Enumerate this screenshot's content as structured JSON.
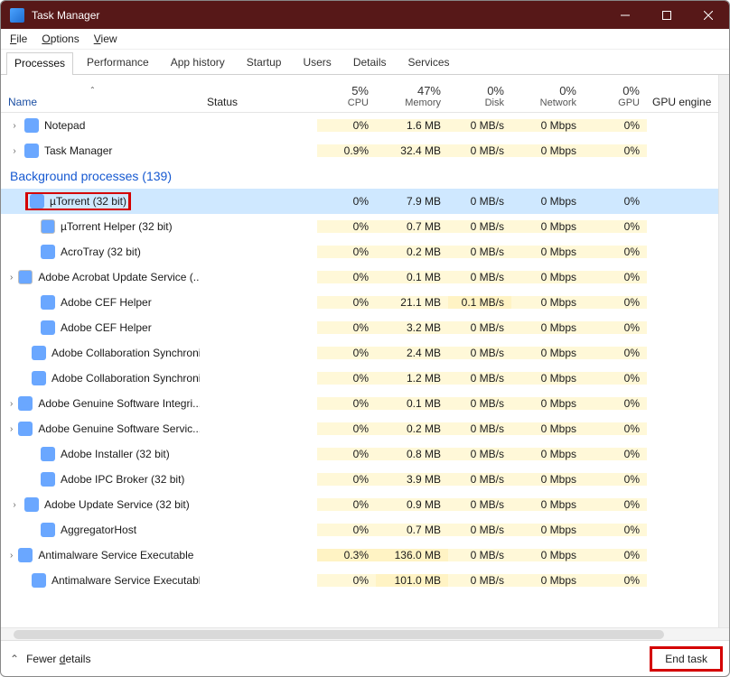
{
  "window": {
    "title": "Task Manager"
  },
  "menu": {
    "file": "File",
    "options": "Options",
    "view": "View"
  },
  "tabs": {
    "processes": "Processes",
    "performance": "Performance",
    "appHistory": "App history",
    "startup": "Startup",
    "users": "Users",
    "details": "Details",
    "services": "Services"
  },
  "columns": {
    "name": "Name",
    "status": "Status",
    "cpu_pct": "5%",
    "cpu_lbl": "CPU",
    "mem_pct": "47%",
    "mem_lbl": "Memory",
    "disk_pct": "0%",
    "disk_lbl": "Disk",
    "net_pct": "0%",
    "net_lbl": "Network",
    "gpu_pct": "0%",
    "gpu_lbl": "GPU",
    "gpuengine": "GPU engine"
  },
  "sections": {
    "background": "Background processes (139)"
  },
  "apps": [
    {
      "name": "Notepad",
      "exp": true,
      "iconClass": "notepad",
      "cpu": "0%",
      "mem": "1.6 MB",
      "disk": "0 MB/s",
      "net": "0 Mbps",
      "gpu": "0%"
    },
    {
      "name": "Task Manager",
      "exp": true,
      "iconClass": "tm",
      "cpu": "0.9%",
      "mem": "32.4 MB",
      "disk": "0 MB/s",
      "net": "0 Mbps",
      "gpu": "0%"
    }
  ],
  "bg": [
    {
      "name": "µTorrent (32 bit)",
      "exp": false,
      "indent": true,
      "iconClass": "utor",
      "selected": true,
      "redbox": true,
      "cpu": "0%",
      "mem": "7.9 MB",
      "disk": "0 MB/s",
      "net": "0 Mbps",
      "gpu": "0%"
    },
    {
      "name": "µTorrent Helper (32 bit)",
      "exp": false,
      "indent": true,
      "iconClass": "helper",
      "cpu": "0%",
      "mem": "0.7 MB",
      "disk": "0 MB/s",
      "net": "0 Mbps",
      "gpu": "0%"
    },
    {
      "name": "AcroTray (32 bit)",
      "exp": false,
      "indent": true,
      "iconClass": "acro",
      "cpu": "0%",
      "mem": "0.2 MB",
      "disk": "0 MB/s",
      "net": "0 Mbps",
      "gpu": "0%"
    },
    {
      "name": "Adobe Acrobat Update Service (...",
      "exp": true,
      "iconClass": "generic",
      "cpu": "0%",
      "mem": "0.1 MB",
      "disk": "0 MB/s",
      "net": "0 Mbps",
      "gpu": "0%"
    },
    {
      "name": "Adobe CEF Helper",
      "exp": false,
      "indent": true,
      "iconClass": "adobe",
      "cpu": "0%",
      "mem": "21.1 MB",
      "disk": "0.1 MB/s",
      "net": "0 Mbps",
      "gpu": "0%",
      "diskHeat": "heat1"
    },
    {
      "name": "Adobe CEF Helper",
      "exp": false,
      "indent": true,
      "iconClass": "adobe",
      "cpu": "0%",
      "mem": "3.2 MB",
      "disk": "0 MB/s",
      "net": "0 Mbps",
      "gpu": "0%"
    },
    {
      "name": "Adobe Collaboration Synchroni...",
      "exp": false,
      "indent": true,
      "iconClass": "collab",
      "cpu": "0%",
      "mem": "2.4 MB",
      "disk": "0 MB/s",
      "net": "0 Mbps",
      "gpu": "0%"
    },
    {
      "name": "Adobe Collaboration Synchroni...",
      "exp": false,
      "indent": true,
      "iconClass": "collab",
      "cpu": "0%",
      "mem": "1.2 MB",
      "disk": "0 MB/s",
      "net": "0 Mbps",
      "gpu": "0%"
    },
    {
      "name": "Adobe Genuine Software Integri...",
      "exp": true,
      "iconClass": "svc",
      "cpu": "0%",
      "mem": "0.1 MB",
      "disk": "0 MB/s",
      "net": "0 Mbps",
      "gpu": "0%"
    },
    {
      "name": "Adobe Genuine Software Servic...",
      "exp": true,
      "iconClass": "svc",
      "cpu": "0%",
      "mem": "0.2 MB",
      "disk": "0 MB/s",
      "net": "0 Mbps",
      "gpu": "0%"
    },
    {
      "name": "Adobe Installer (32 bit)",
      "exp": false,
      "indent": true,
      "iconClass": "installer",
      "cpu": "0%",
      "mem": "0.8 MB",
      "disk": "0 MB/s",
      "net": "0 Mbps",
      "gpu": "0%"
    },
    {
      "name": "Adobe IPC Broker (32 bit)",
      "exp": false,
      "indent": true,
      "iconClass": "ipc",
      "cpu": "0%",
      "mem": "3.9 MB",
      "disk": "0 MB/s",
      "net": "0 Mbps",
      "gpu": "0%"
    },
    {
      "name": "Adobe Update Service (32 bit)",
      "exp": true,
      "iconClass": "adobe",
      "cpu": "0%",
      "mem": "0.9 MB",
      "disk": "0 MB/s",
      "net": "0 Mbps",
      "gpu": "0%"
    },
    {
      "name": "AggregatorHost",
      "exp": false,
      "indent": true,
      "iconClass": "aggr",
      "cpu": "0%",
      "mem": "0.7 MB",
      "disk": "0 MB/s",
      "net": "0 Mbps",
      "gpu": "0%"
    },
    {
      "name": "Antimalware Service Executable",
      "exp": true,
      "iconClass": "defender",
      "cpu": "0.3%",
      "mem": "136.0 MB",
      "disk": "0 MB/s",
      "net": "0 Mbps",
      "gpu": "0%",
      "cpuHeat": "heat1",
      "memHeat": "heat1"
    },
    {
      "name": "Antimalware Service Executable...",
      "exp": false,
      "indent": true,
      "iconClass": "defender",
      "cpu": "0%",
      "mem": "101.0 MB",
      "disk": "0 MB/s",
      "net": "0 Mbps",
      "gpu": "0%",
      "memHeat": "heat1"
    }
  ],
  "footer": {
    "fewerDetails": "Fewer details",
    "fewerU": "d",
    "endTask": "End task",
    "endU": "E"
  }
}
